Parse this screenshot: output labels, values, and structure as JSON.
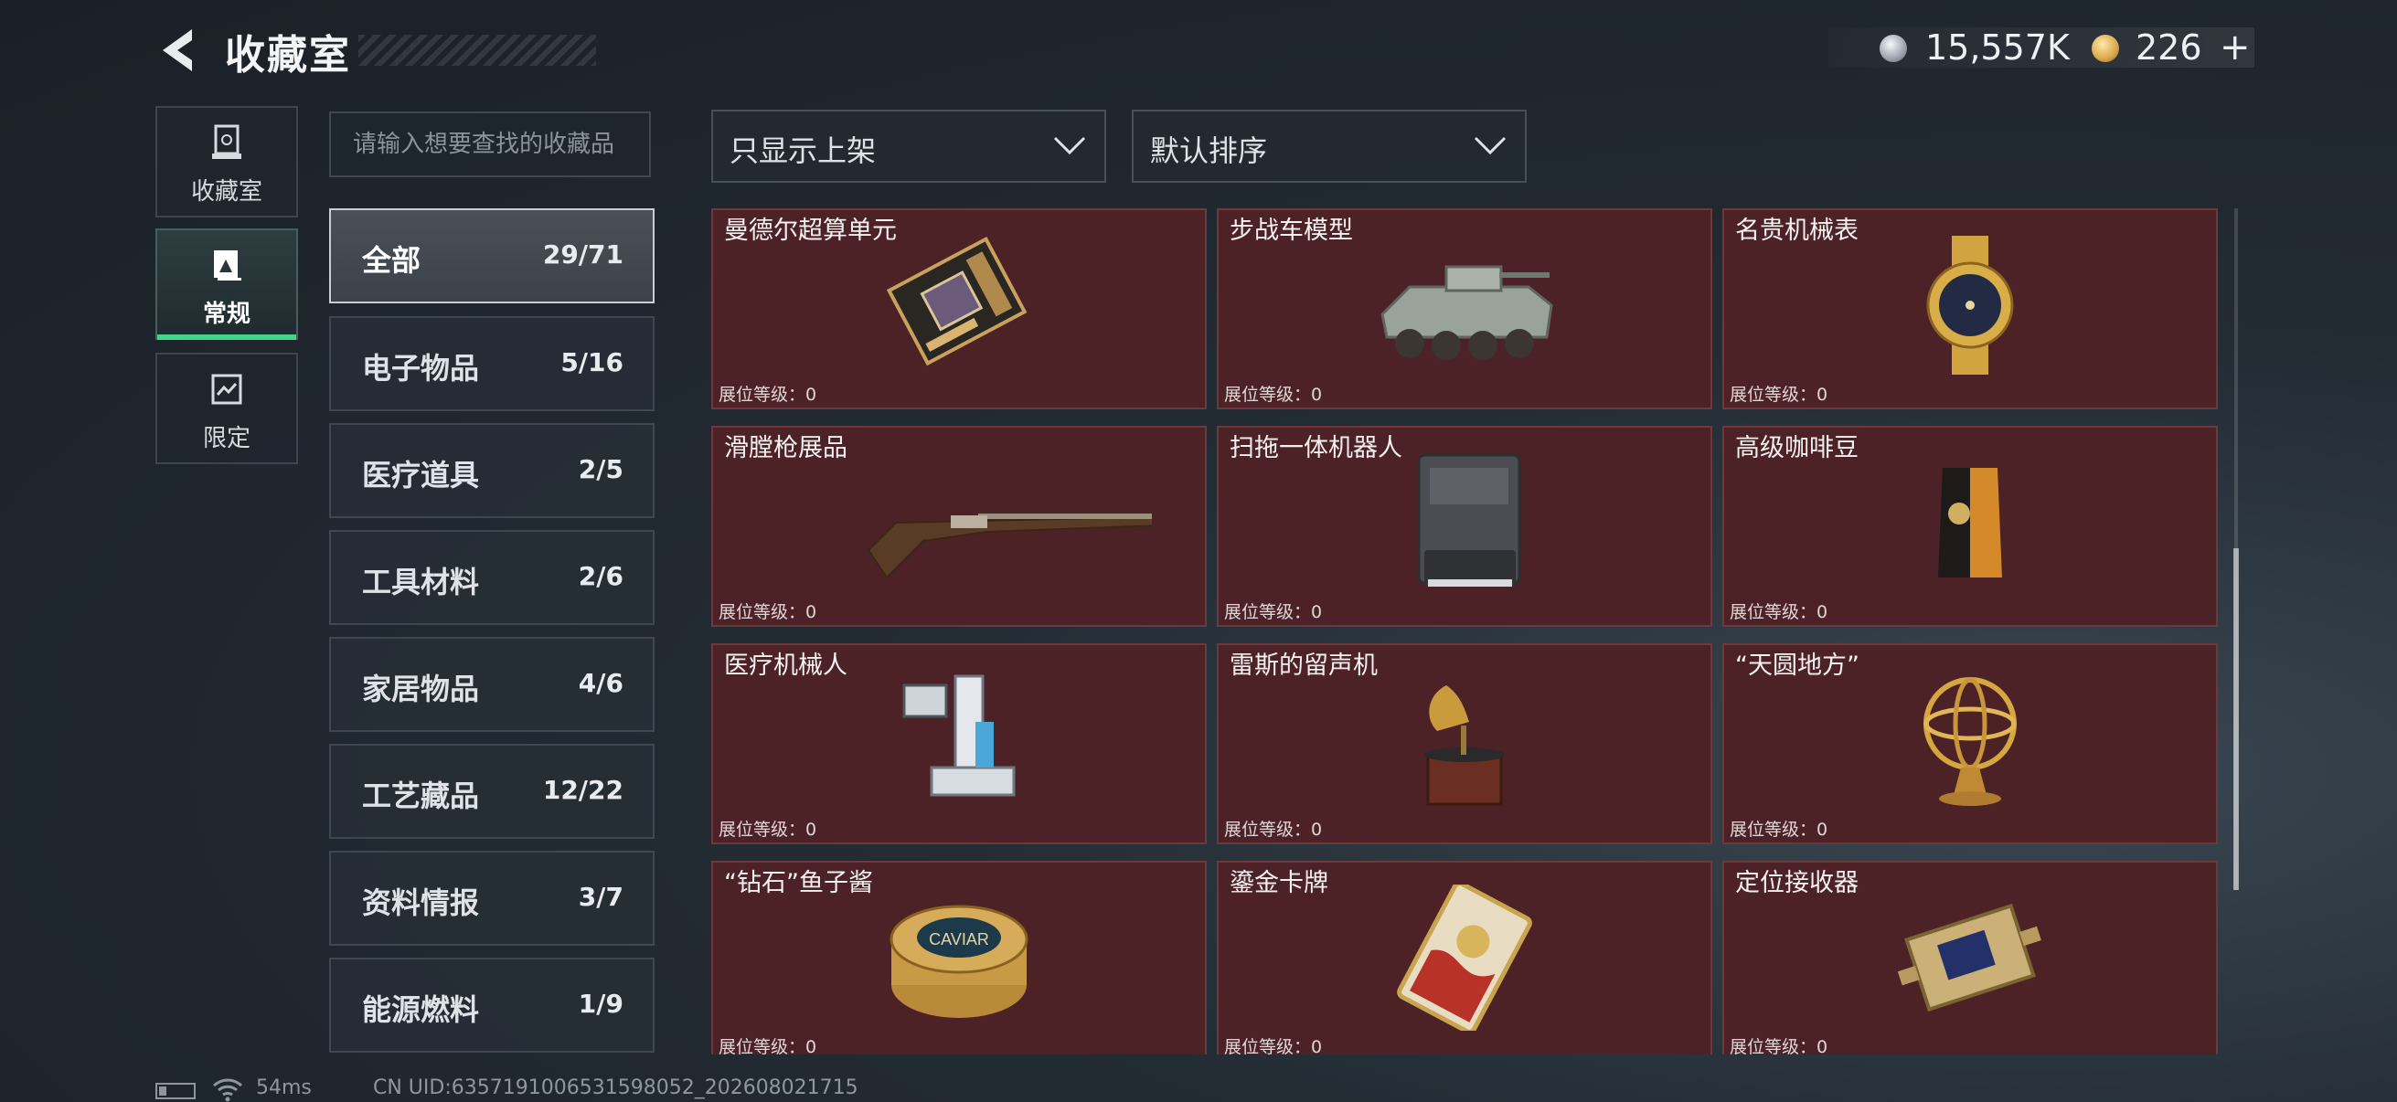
{
  "header": {
    "title": "收藏室",
    "currency": {
      "silver": "15,557K",
      "gold": "226",
      "add": "+"
    }
  },
  "rail": [
    {
      "label": "收藏室"
    },
    {
      "label": "常规"
    },
    {
      "label": "限定"
    }
  ],
  "search": {
    "placeholder": "请输入想要查找的收藏品"
  },
  "filters": {
    "display": "只显示上架",
    "sort": "默认排序"
  },
  "categories": [
    {
      "name": "全部",
      "count": "29/71"
    },
    {
      "name": "电子物品",
      "count": "5/16"
    },
    {
      "name": "医疗道具",
      "count": "2/5"
    },
    {
      "name": "工具材料",
      "count": "2/6"
    },
    {
      "name": "家居物品",
      "count": "4/6"
    },
    {
      "name": "工艺藏品",
      "count": "12/22"
    },
    {
      "name": "资料情报",
      "count": "3/7"
    },
    {
      "name": "能源燃料",
      "count": "1/9"
    }
  ],
  "items": [
    {
      "name": "曼德尔超算单元",
      "level": "展位等级：0",
      "icon": "supercomputer-unit-icon"
    },
    {
      "name": "步战车模型",
      "level": "展位等级：0",
      "icon": "ifv-model-icon"
    },
    {
      "name": "名贵机械表",
      "level": "展位等级：0",
      "icon": "luxury-watch-icon"
    },
    {
      "name": "滑膛枪展品",
      "level": "展位等级：0",
      "icon": "musket-icon"
    },
    {
      "name": "扫拖一体机器人",
      "level": "展位等级：0",
      "icon": "robot-vacuum-icon"
    },
    {
      "name": "高级咖啡豆",
      "level": "展位等级：0",
      "icon": "coffee-bag-icon"
    },
    {
      "name": "医疗机械人",
      "level": "展位等级：0",
      "icon": "medical-robot-icon"
    },
    {
      "name": "雷斯的留声机",
      "level": "展位等级：0",
      "icon": "gramophone-icon"
    },
    {
      "name": "“天圆地方”",
      "level": "展位等级：0",
      "icon": "armillary-sphere-icon"
    },
    {
      "name": "“钻石”鱼子酱",
      "level": "展位等级：0",
      "icon": "caviar-tin-icon"
    },
    {
      "name": "鎏金卡牌",
      "level": "展位等级：0",
      "icon": "gilded-card-icon"
    },
    {
      "name": "定位接收器",
      "level": "展位等级：0",
      "icon": "gps-receiver-icon"
    }
  ],
  "caviar_label": "CAVIAR",
  "footer": {
    "ping": "54ms",
    "uid": "CN UID:6357191006531598052_202608021715"
  },
  "colors": {
    "card_bg": "#4c2226",
    "accent": "#40d58a"
  }
}
